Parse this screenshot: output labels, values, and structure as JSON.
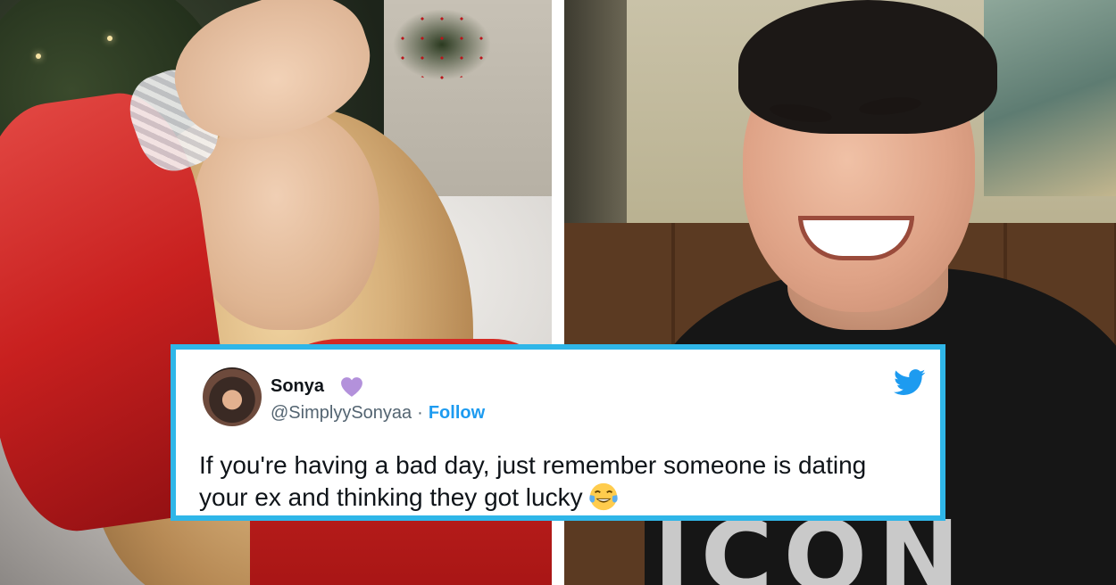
{
  "images": {
    "left_photo": "woman-in-red-with-hand-on-forehead",
    "right_photo": "man-laughing-in-black-shirt"
  },
  "shirt_text": "ICON",
  "tweet": {
    "display_name": "Sonya",
    "handle": "@SimplyySonyaa",
    "separator": "·",
    "follow_label": "Follow",
    "text": "If you're having a bad day, just remember someone is dating your ex and thinking they got lucky",
    "emoji": "tears-of-joy",
    "icons": {
      "badge": "purple-heart-icon",
      "platform": "twitter-bird-icon"
    }
  },
  "colors": {
    "card_border": "#2fb6e8",
    "link": "#1d9bf0",
    "heart": "#b391db",
    "text": "#0f1419",
    "muted": "#536471"
  }
}
